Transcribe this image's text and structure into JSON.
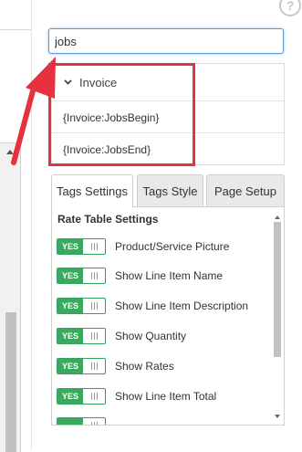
{
  "search": {
    "value": "jobs"
  },
  "results": {
    "group_label": "Invoice",
    "items": [
      {
        "label": "{Invoice:JobsBegin}"
      },
      {
        "label": "{Invoice:JobsEnd}"
      }
    ]
  },
  "tabs": [
    {
      "label": "Tags Settings",
      "active": true
    },
    {
      "label": "Tags Style",
      "active": false
    },
    {
      "label": "Page Setup",
      "active": false
    }
  ],
  "settings": {
    "title": "Rate Table Settings",
    "toggle_on_label": "YES",
    "rows": [
      {
        "label": "Product/Service Picture",
        "enabled": true
      },
      {
        "label": "Show Line Item Name",
        "enabled": true
      },
      {
        "label": "Show Line Item Description",
        "enabled": true
      },
      {
        "label": "Show Quantity",
        "enabled": true
      },
      {
        "label": "Show Rates",
        "enabled": true
      },
      {
        "label": "Show Line Item Total",
        "enabled": true
      }
    ]
  },
  "help": {
    "glyph": "?"
  },
  "colors": {
    "accent_red": "#e5323e",
    "toggle_green": "#3aaa5e",
    "focus_blue": "#5b9bd5"
  }
}
